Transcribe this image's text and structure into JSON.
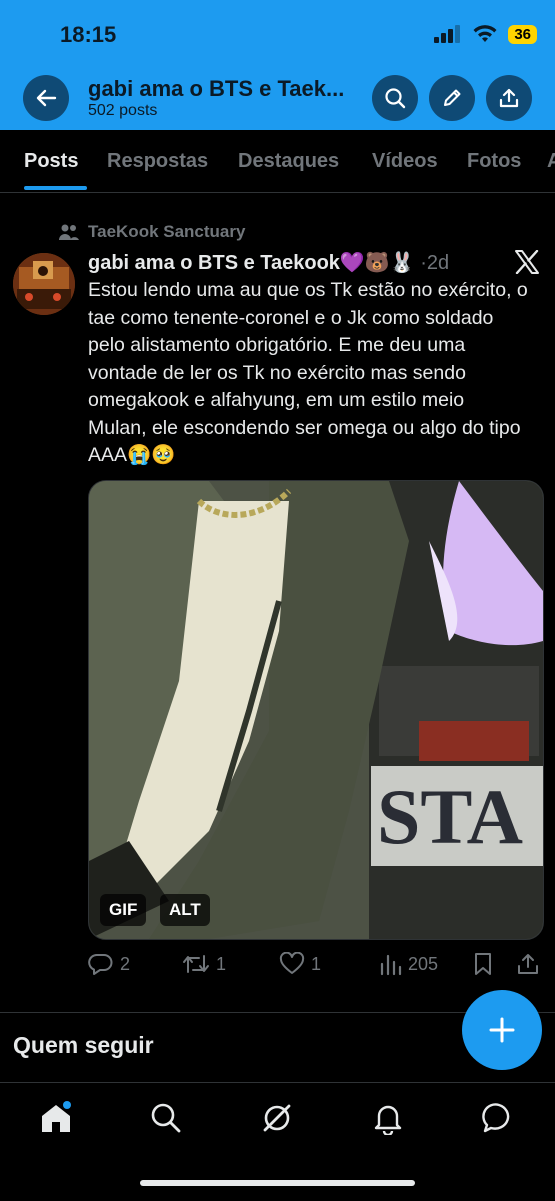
{
  "status_bar": {
    "time": "18:15",
    "battery": "36"
  },
  "header": {
    "title": "gabi ama o BTS e Taek...",
    "subtitle": "502 posts"
  },
  "tabs": [
    {
      "label": "Posts",
      "active": true
    },
    {
      "label": "Respostas",
      "active": false
    },
    {
      "label": "Destaques",
      "active": false
    },
    {
      "label": "Vídeos",
      "active": false
    },
    {
      "label": "Fotos",
      "active": false
    },
    {
      "label": "A",
      "active": false
    }
  ],
  "post": {
    "community": "TaeKook Sanctuary",
    "author_name": "gabi ama o BTS e Taekook💜🐻🐰",
    "time": "·2d",
    "text": "Estou lendo uma au que os Tk estão no exército, o tae como tenente-coronel e o Jk como soldado pelo alistamento obrigatório. E me deu uma vontade de ler os Tk no exército mas sendo omegakook e alfahyung, em um estilo meio Mulan, ele escondendo ser omega ou algo do tipo AAA😭🥹",
    "media_badges": [
      "GIF",
      "ALT"
    ],
    "media_sign_text": "STA",
    "stats": {
      "replies": "2",
      "reposts": "1",
      "likes": "1",
      "views": "205"
    }
  },
  "who_to_follow": {
    "title": "Quem seguir"
  },
  "colors": {
    "accent": "#1d9bf0",
    "background": "#000000",
    "muted": "#71767b"
  },
  "icons": [
    "back-arrow-icon",
    "search-icon",
    "edit-pencil-icon",
    "share-icon",
    "x-logo-icon",
    "reply-icon",
    "repost-icon",
    "like-icon",
    "views-icon",
    "bookmark-icon",
    "home-icon",
    "explore-icon",
    "grok-icon",
    "notifications-icon",
    "messages-icon",
    "compose-plus-icon"
  ]
}
